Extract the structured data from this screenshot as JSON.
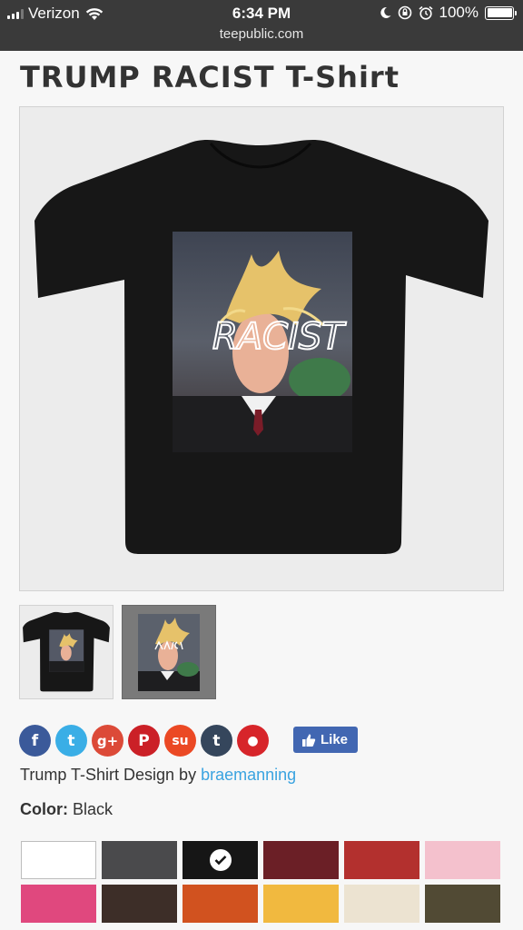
{
  "status_bar": {
    "carrier": "Verizon",
    "time": "6:34 PM",
    "url": "teepublic.com",
    "battery": "100%"
  },
  "product": {
    "title": "TRUMP RACIST T-Shirt",
    "design_text": "RACIST",
    "byline_prefix": "Trump T-Shirt Design by",
    "designer": "braemanning",
    "color_label": "Color:",
    "color_value": "Black"
  },
  "social": {
    "icons": [
      "facebook-icon",
      "twitter-icon",
      "google-plus-icon",
      "pinterest-icon",
      "stumbleupon-icon",
      "tumblr-icon",
      "reddit-icon"
    ],
    "glyphs": [
      "f",
      "t",
      "g+",
      "P",
      "su",
      "t",
      "●"
    ],
    "colors": [
      "#3b5a9a",
      "#3aaee6",
      "#dc4a38",
      "#cb2027",
      "#eb4924",
      "#35465c",
      "#d7252a"
    ],
    "like_label": "Like"
  },
  "swatches": {
    "colors": [
      "#ffffff",
      "#4a4a4c",
      "#161616",
      "#6b1f26",
      "#b3302e",
      "#f4c1cd",
      "#e0487e",
      "#3d2e28",
      "#d1521f",
      "#f1b93f",
      "#ece3d1",
      "#514a34"
    ],
    "selected_index": 2
  }
}
